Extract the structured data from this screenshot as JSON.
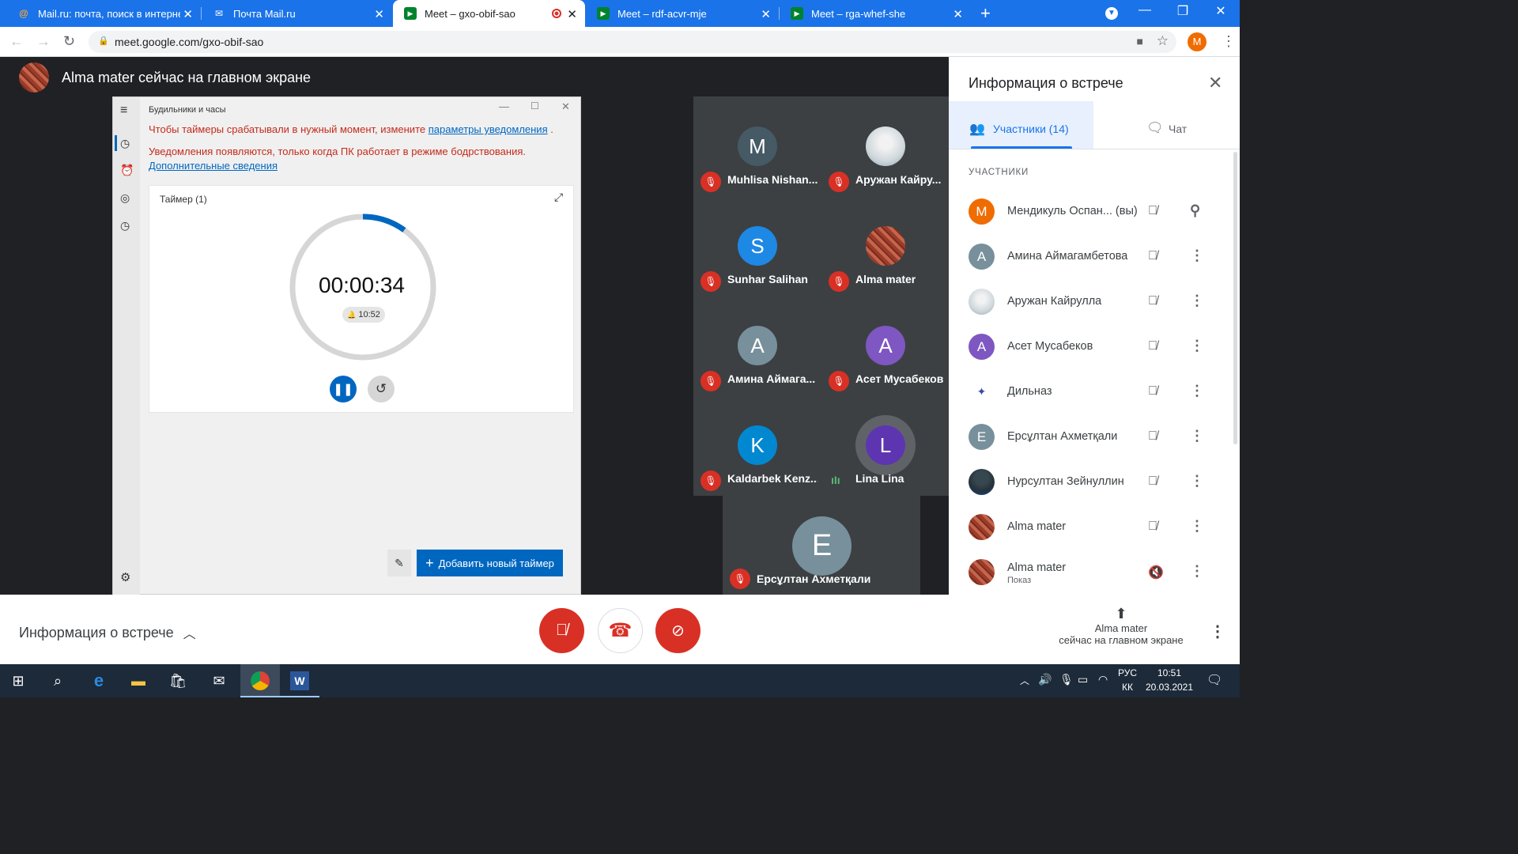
{
  "browser": {
    "tabs": [
      {
        "title": "Mail.ru: почта, поиск в интерне",
        "icon": "at-icon"
      },
      {
        "title": "Почта Mail.ru",
        "icon": "mail-icon"
      },
      {
        "title": "Meet – gxo-obif-sao",
        "icon": "meet-icon",
        "active": true
      },
      {
        "title": "Meet – rdf-acvr-mje",
        "icon": "meet-icon"
      },
      {
        "title": "Meet – rga-whef-she",
        "icon": "meet-icon"
      }
    ],
    "new_tab": "+",
    "url": "meet.google.com/gxo-obif-sao",
    "profile_letter": "M"
  },
  "meet": {
    "presenter_banner": "Alma mater сейчас на главном экране",
    "shared_window": {
      "title": "Будильники и часы",
      "warning_text": "Чтобы таймеры срабатывали в нужный момент, измените",
      "warning_link": "параметры уведомления",
      "warning_end": ".",
      "notice": "Уведомления появляются, только когда ПК работает в режиме бодрствования.",
      "more_link": "Дополнительные сведения",
      "timer_label": "Таймер (1)",
      "timer_value": "00:00:34",
      "alarm_time": "10:52",
      "timer_progress": 0.1,
      "add_timer": "Добавить новый таймер"
    },
    "tiles": [
      {
        "name": "Muhlisa Nishan...",
        "letter": "M",
        "color": "#455a64",
        "mic": "muted"
      },
      {
        "name": "Аружан Кайру...",
        "letter": "",
        "color": "#cfd8dc",
        "mic": "muted",
        "photo": true
      },
      {
        "name": "Sunhar Salihan",
        "letter": "S",
        "color": "#1e88e5",
        "mic": "muted"
      },
      {
        "name": "Alma mater",
        "letter": "",
        "color": "#a0402a",
        "mic": "muted",
        "photo": true
      },
      {
        "name": "Амина Аймага...",
        "letter": "A",
        "color": "#78909c",
        "mic": "muted"
      },
      {
        "name": "Асет Мусабеков",
        "letter": "A",
        "color": "#7e57c2",
        "mic": "muted"
      },
      {
        "name": "Kaldarbek Kenz...",
        "letter": "K",
        "color": "#0288d1",
        "mic": "muted"
      },
      {
        "name": "Lina Lina",
        "letter": "L",
        "color": "#5e35b1",
        "mic": "speaking"
      }
    ],
    "featured_tile": {
      "name": "Ерсұлтан Ахметқали",
      "letter": "E",
      "color": "#78909c"
    }
  },
  "panel": {
    "title": "Информация о встрече",
    "tab_people": "Участники (14)",
    "tab_chat": "Чат",
    "section_label": "УЧАСТНИКИ",
    "participants": [
      {
        "name": "Мендикуль Оспан... (вы)",
        "letter": "M",
        "color": "#ef6c00",
        "action": "pin"
      },
      {
        "name": "Амина Аймагамбетова",
        "letter": "A",
        "color": "#78909c",
        "action": "more"
      },
      {
        "name": "Аружан Кайрулла",
        "letter": "",
        "color": "#cfd8dc",
        "photo": true,
        "action": "more"
      },
      {
        "name": "Асет Мусабеков",
        "letter": "A",
        "color": "#7e57c2",
        "action": "more"
      },
      {
        "name": "Дильназ",
        "letter": "",
        "color": "#ffffff",
        "photo": true,
        "action": "more"
      },
      {
        "name": "Ерсұлтан Ахметқали",
        "letter": "E",
        "color": "#78909c",
        "action": "more"
      },
      {
        "name": "Нурсултан Зейнуллин",
        "letter": "",
        "color": "#263238",
        "photo": true,
        "action": "more"
      },
      {
        "name": "Alma mater",
        "letter": "",
        "color": "#a0402a",
        "photo": true,
        "action": "more"
      },
      {
        "name": "Alma mater",
        "sub": "Показ",
        "letter": "",
        "color": "#a0402a",
        "photo": true,
        "action": "more"
      }
    ]
  },
  "bottom": {
    "meeting_info": "Информация о встрече",
    "present_line1": "Alma mater",
    "present_line2": "сейчас на главном экране"
  },
  "taskbar": {
    "lang_top": "РУС",
    "lang_bottom": "КК",
    "time": "10:51",
    "date": "20.03.2021"
  }
}
